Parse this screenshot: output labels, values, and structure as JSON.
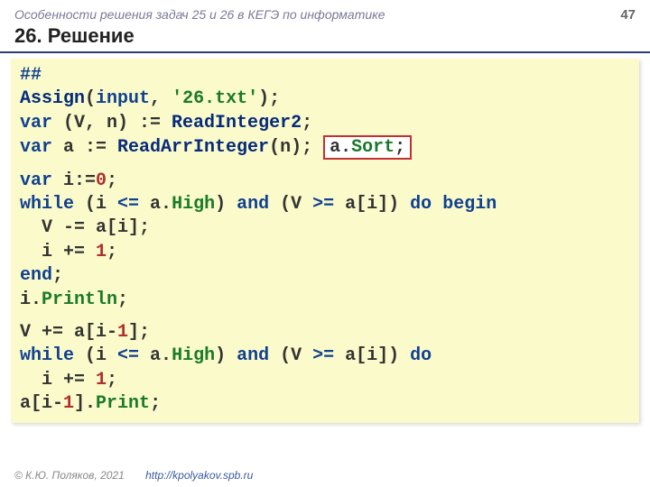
{
  "header": {
    "subtitle": "Особенности решения задач 25 и 26 в КЕГЭ по информатике",
    "page": "47"
  },
  "title": "26. Решение",
  "code": {
    "l1_a": "##",
    "l2_a": "Assign",
    "l2_b": "(",
    "l2_c": "input",
    "l2_d": ", ",
    "l2_e": "'26.txt'",
    "l2_f": ");",
    "l3_a": "var",
    "l3_b": " (V, n) := ",
    "l3_c": "ReadInteger2",
    "l3_d": ";",
    "l4_a": "var",
    "l4_b": " a := ",
    "l4_c": "ReadArrInteger",
    "l4_d": "(n); ",
    "l4_box_a": "a.",
    "l4_box_b": "Sort",
    "l4_box_c": ";",
    "l5_a": "var",
    "l5_b": " i:=",
    "l5_c": "0",
    "l5_d": ";",
    "l6_a": "while",
    "l6_b": " (i ",
    "l6_c": "<=",
    "l6_d": " a.",
    "l6_e": "High",
    "l6_f": ") ",
    "l6_g": "and",
    "l6_h": " (V ",
    "l6_i": ">=",
    "l6_j": " a[i]) ",
    "l6_k": "do",
    "l6_l": " ",
    "l6_m": "begin",
    "l7": "  V -= a[i];",
    "l8_a": "  i += ",
    "l8_b": "1",
    "l8_c": ";",
    "l9_a": "end",
    "l9_b": ";",
    "l10_a": "i.",
    "l10_b": "Println",
    "l10_c": ";",
    "l11_a": "V += a[i-",
    "l11_b": "1",
    "l11_c": "];",
    "l12_a": "while",
    "l12_b": " (i ",
    "l12_c": "<=",
    "l12_d": " a.",
    "l12_e": "High",
    "l12_f": ") ",
    "l12_g": "and",
    "l12_h": " (V ",
    "l12_i": ">=",
    "l12_j": " a[i]) ",
    "l12_k": "do",
    "l13_a": "  i += ",
    "l13_b": "1",
    "l13_c": ";",
    "l14_a": "a[i-",
    "l14_b": "1",
    "l14_c": "].",
    "l14_d": "Print",
    "l14_e": ";"
  },
  "footer": {
    "copyright": "© К.Ю. Поляков, 2021",
    "url": "http://kpolyakov.spb.ru"
  }
}
